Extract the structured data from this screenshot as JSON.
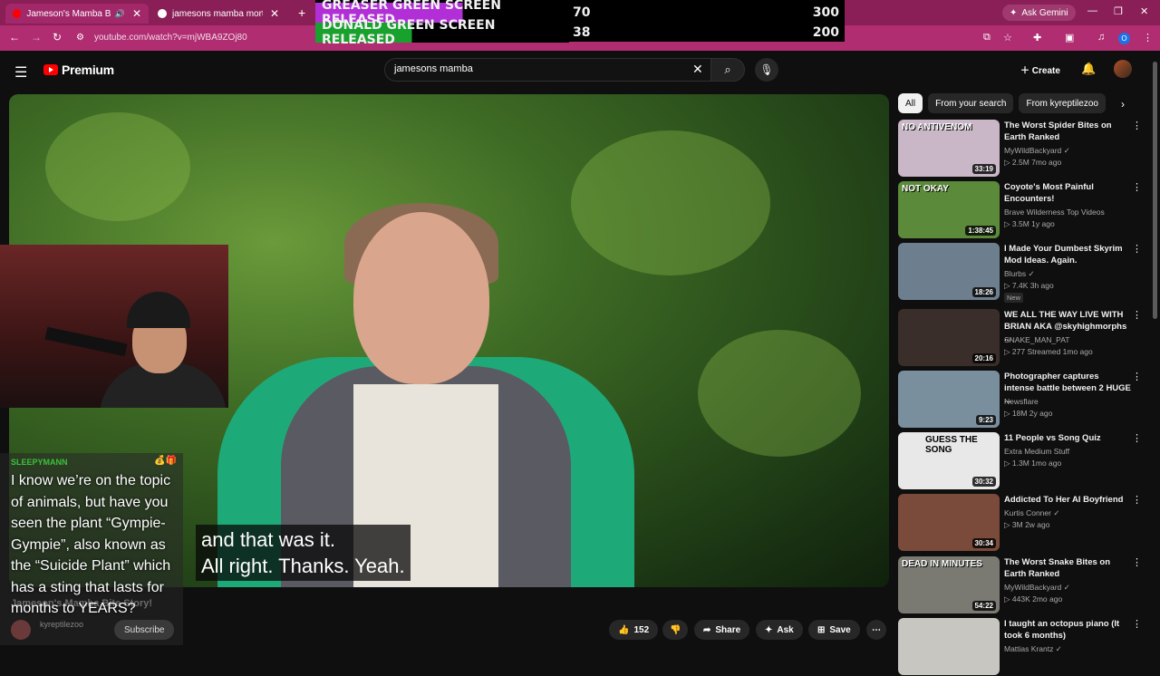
{
  "browser": {
    "tabs": [
      {
        "label": "Jameson's Mamba Bite Story!",
        "active": true,
        "color": "#ff0000"
      },
      {
        "label": "jamesons mamba mortality rate",
        "active": false,
        "color": "#ffffff"
      }
    ],
    "ask_gemini": "Ask Gemini",
    "url": "youtube.com/watch?v=mjWBA9ZOj80",
    "profile_initial": "O"
  },
  "overlay": {
    "rows": [
      {
        "label": "GREASER GREEN SCREEN RELEASED",
        "value": "70",
        "target": "300"
      },
      {
        "label": "DONALD GREEN SCREEN RELEASED",
        "value": "38",
        "target": "200"
      }
    ]
  },
  "youtube": {
    "logo": "Premium",
    "search_value": "jamesons mamba",
    "create": "Create"
  },
  "stream": {
    "chat_user": "SLEEPYMANN",
    "chat_message": "I know we’re on the topic of animals, but have you seen the plant “Gympie-Gympie”, also known as the “Suicide Plant” which has a sting that lasts for months to YEARS?",
    "subtitle_lines": [
      "and that was it.",
      "All right. Thanks. Yeah."
    ]
  },
  "video_info": {
    "title": "Jameson's Mamba Bite Story!",
    "channel": "kyreptilezoo",
    "subscribe": "Subscribe",
    "likes": "152",
    "share": "Share",
    "ask": "Ask",
    "save": "Save"
  },
  "chips": [
    "All",
    "From your search",
    "From kyreptilezoo"
  ],
  "recommendations": [
    {
      "title": "The Worst Spider Bites on Earth Ranked",
      "channel": "MyWildBackyard",
      "meta": "2.5M  7mo ago",
      "duration": "33:19",
      "thumb_text": "NO ANTIVENOM",
      "thumb_color": "#c9b7c8",
      "verified": true
    },
    {
      "title": "Coyote's Most Painful Encounters!",
      "channel": "Brave Wilderness Top Videos",
      "meta": "3.5M  1y ago",
      "duration": "1:38:45",
      "thumb_text": "NOT OKAY",
      "thumb_color": "#5b8a3a",
      "verified": false
    },
    {
      "title": "I Made Your Dumbest Skyrim Mod Ideas. Again.",
      "channel": "Blurbs",
      "meta": "7.4K  3h ago",
      "duration": "18:26",
      "thumb_text": "",
      "thumb_color": "#6d7f8e",
      "verified": true,
      "badge": "New"
    },
    {
      "title": "WE ALL THE WAY LIVE WITH BRIAN AKA @skyhighmorphs ...",
      "channel": "SNAKE_MAN_PAT",
      "meta": "277  Streamed 1mo ago",
      "duration": "20:16",
      "thumb_text": "",
      "thumb_color": "#3a2e2a",
      "verified": false
    },
    {
      "title": "Photographer captures intense battle between 2 HUGE ...",
      "channel": "Newsflare",
      "meta": "18M  2y ago",
      "duration": "9:23",
      "thumb_text": "",
      "thumb_color": "#7a8f9e",
      "verified": false
    },
    {
      "title": "11 People vs Song Quiz",
      "channel": "Extra Medium Stuff",
      "meta": "1.3M  1mo ago",
      "duration": "30:32",
      "thumb_text": "GUESS THE SONG",
      "thumb_color": "#e8e8e8",
      "verified": false
    },
    {
      "title": "Addicted To Her AI Boyfriend",
      "channel": "Kurtis Conner",
      "meta": "3M  2w ago",
      "duration": "30:34",
      "thumb_text": "",
      "thumb_color": "#7a4a3a",
      "verified": true
    },
    {
      "title": "The Worst Snake Bites on Earth Ranked",
      "channel": "MyWildBackyard",
      "meta": "443K  2mo ago",
      "duration": "54:22",
      "thumb_text": "DEAD IN MINUTES",
      "thumb_color": "#7a7a72",
      "verified": true
    },
    {
      "title": "I taught an octopus piano (It took 6 months)",
      "channel": "Mattias Krantz",
      "meta": "",
      "duration": "",
      "thumb_text": "",
      "thumb_color": "#c8c6c0",
      "verified": true
    }
  ]
}
